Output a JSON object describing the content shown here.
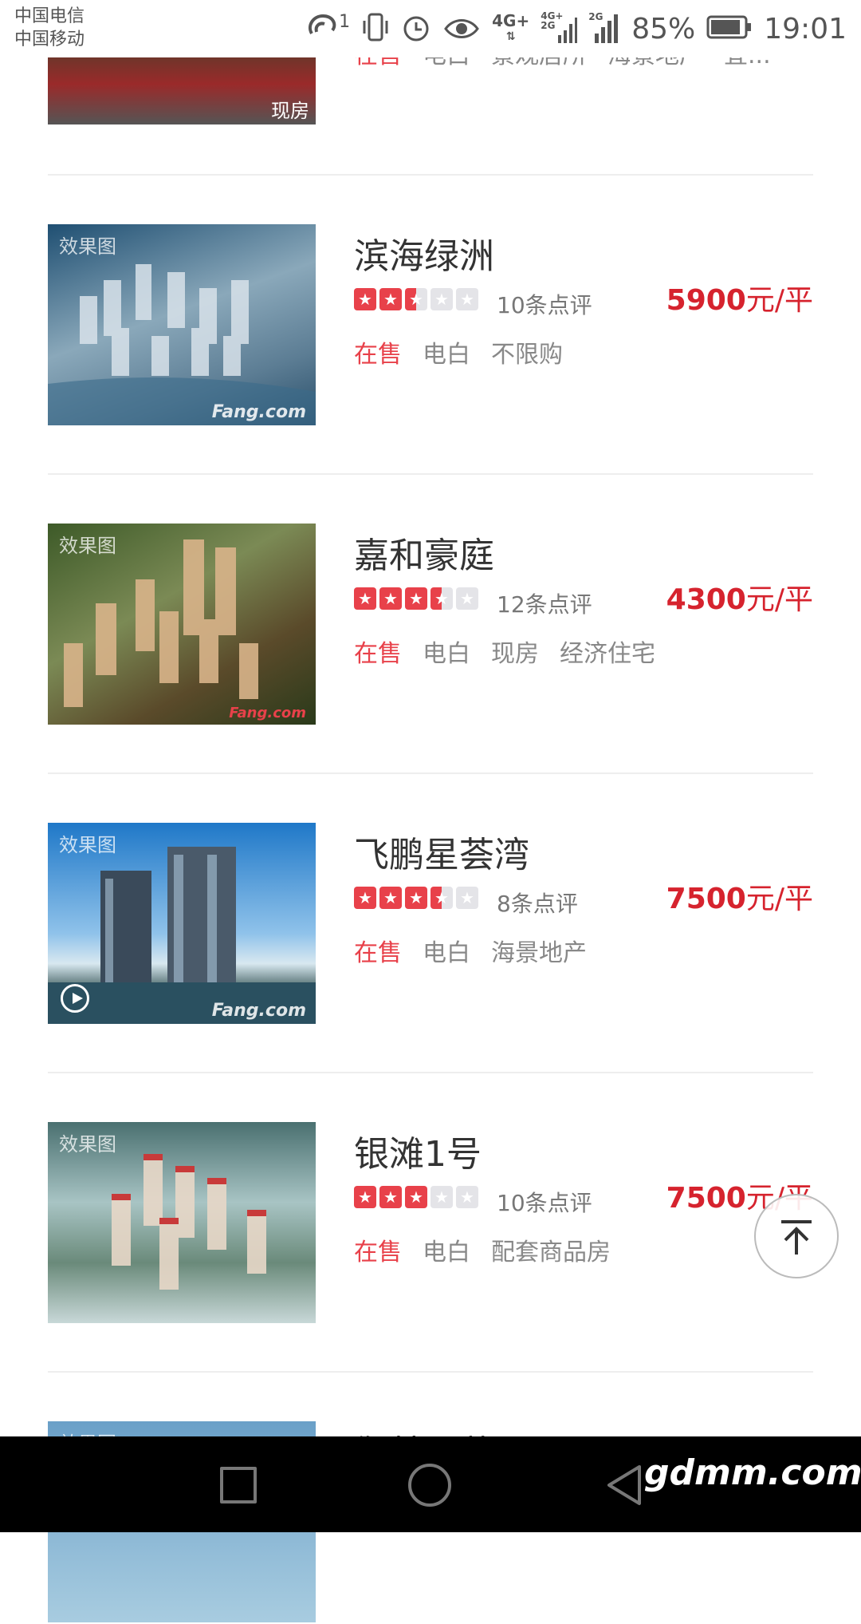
{
  "status_bar": {
    "carrier1": "中国电信",
    "carrier2": "中国移动",
    "sim_badge": "1",
    "net1": "4G+",
    "net2": "4G+",
    "net3": "2G",
    "net4": "2G",
    "battery": "85%",
    "time": "19:01"
  },
  "top_item": {
    "tags": [
      "在售",
      "电白",
      "景观居所",
      "海景地产",
      "宜..."
    ],
    "badge": "现房"
  },
  "items": [
    {
      "name": "滨海绿洲",
      "rating": 2.5,
      "reviews": "10条点评",
      "price": "5900",
      "unit": "元/平",
      "tags": [
        "在售",
        "电白",
        "不限购"
      ],
      "thumb_label": "效果图",
      "watermark": "Fang.com",
      "thumb_colors": [
        "#2a5a7a",
        "#7a9cb0"
      ]
    },
    {
      "name": "嘉和豪庭",
      "rating": 3.5,
      "reviews": "12条点评",
      "price": "4300",
      "unit": "元/平",
      "tags": [
        "在售",
        "电白",
        "现房",
        "经济住宅"
      ],
      "thumb_label": "效果图",
      "watermark": "Fang.com",
      "thumb_colors": [
        "#4a6a2a",
        "#8a7a4a"
      ]
    },
    {
      "name": "飞鹏星荟湾",
      "rating": 3.5,
      "reviews": "8条点评",
      "price": "7500",
      "unit": "元/平",
      "tags": [
        "在售",
        "电白",
        "海景地产"
      ],
      "thumb_label": "效果图",
      "watermark": "Fang.com",
      "thumb_colors": [
        "#2f8ad0",
        "#9cc8ea"
      ]
    },
    {
      "name": "银滩1号",
      "rating": 3,
      "reviews": "10条点评",
      "price": "7500",
      "unit": "元/平",
      "tags": [
        "在售",
        "电白",
        "配套商品房"
      ],
      "thumb_label": "效果图",
      "thumb_colors": [
        "#5a7a7a",
        "#a8c0c0"
      ]
    }
  ],
  "partial_item": {
    "name": "御林星苑",
    "thumb_label": "效果图"
  },
  "nav": {
    "site_mark": "gdmm.com"
  }
}
